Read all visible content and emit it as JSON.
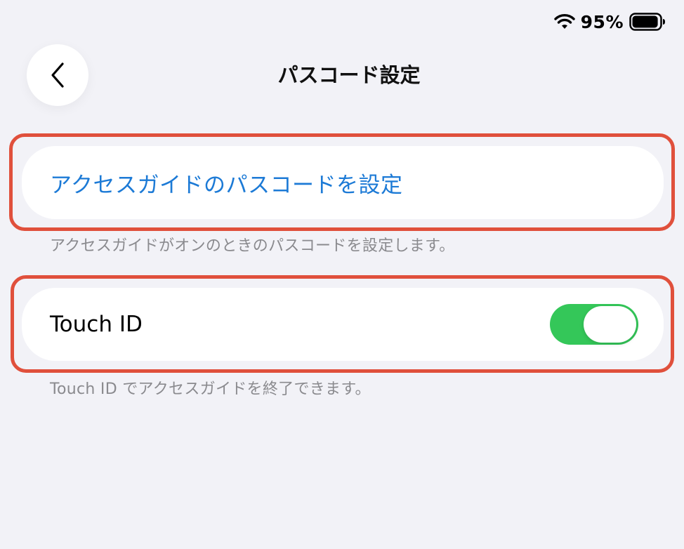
{
  "status_bar": {
    "battery_percent": "95%",
    "battery_level": 0.95,
    "wifi_icon": "wifi-icon",
    "battery_icon": "battery-icon"
  },
  "nav": {
    "back_icon": "chevron-left-icon",
    "title": "パスコード設定"
  },
  "sections": {
    "passcode": {
      "link_label": "アクセスガイドのパスコードを設定",
      "footnote": "アクセスガイドがオンのときのパスコードを設定します。"
    },
    "touch_id": {
      "label": "Touch ID",
      "toggle_on": true,
      "footnote": "Touch ID でアクセスガイドを終了できます。"
    }
  },
  "colors": {
    "background": "#f2f2f7",
    "link": "#1c7ad6",
    "toggle_on": "#34c759",
    "highlight": "#e0503c",
    "footnote": "#8a8a8e"
  }
}
